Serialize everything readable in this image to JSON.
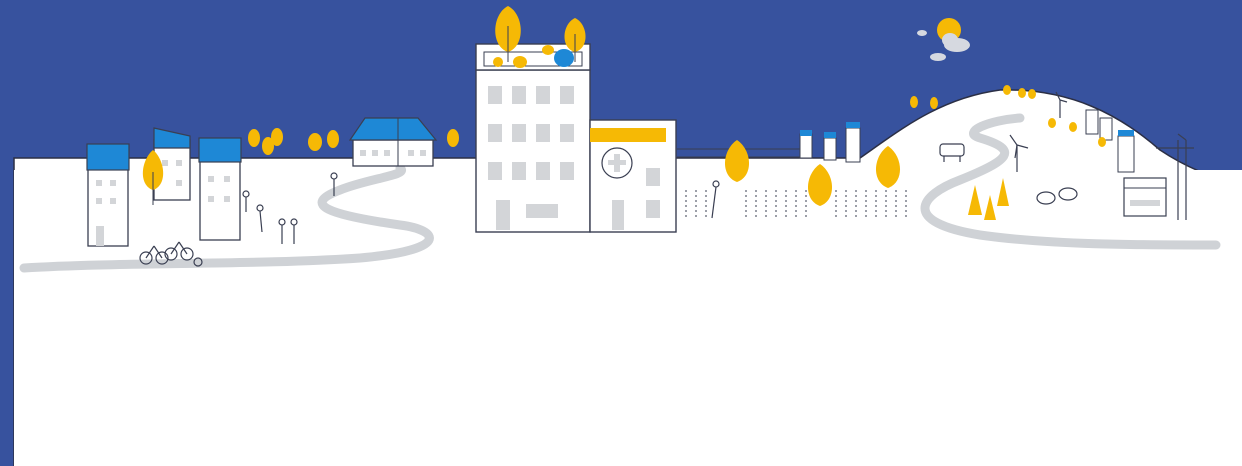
{
  "image": {
    "description_elements": [
      "sky",
      "sun",
      "clouds",
      "apartment-blocks",
      "house",
      "hospital",
      "cyclists",
      "pedestrians",
      "winding-path",
      "field",
      "hill",
      "village",
      "wind-turbines",
      "sheep",
      "cow",
      "factory",
      "crane"
    ]
  },
  "colors": {
    "sky": "#37529E",
    "ground": "#ffffff",
    "line": "#3a3f52",
    "roof_blue": "#1E88D6",
    "tree_yellow": "#F6B905",
    "path_grey": "#cfd2d6",
    "window_grey": "#d3d5d8",
    "sun": "#F6B905",
    "cloud": "#d6d9e0"
  }
}
